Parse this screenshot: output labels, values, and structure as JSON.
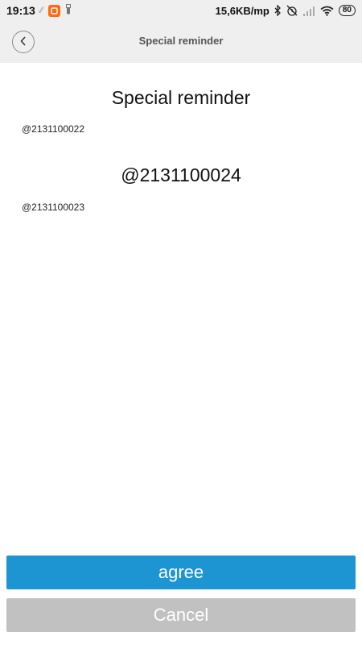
{
  "status_bar": {
    "time": "19:13",
    "net_speed": "15,6KB/mp",
    "battery": "80",
    "icons": [
      "notification-app-icon",
      "usb-icon",
      "bluetooth-icon",
      "alarm-off-icon",
      "signal-icon",
      "wifi-icon",
      "battery-icon"
    ]
  },
  "header": {
    "title": "Special reminder",
    "back_icon": "chevron-left-icon"
  },
  "content": {
    "title": "Special reminder",
    "line1": "@2131100022",
    "line2": "@2131100024",
    "line3": "@2131100023"
  },
  "actions": {
    "agree_label": "agree",
    "cancel_label": "Cancel"
  },
  "colors": {
    "agree": "#1e95d3",
    "cancel": "#c1c1c1",
    "header_bg": "#efefef"
  }
}
